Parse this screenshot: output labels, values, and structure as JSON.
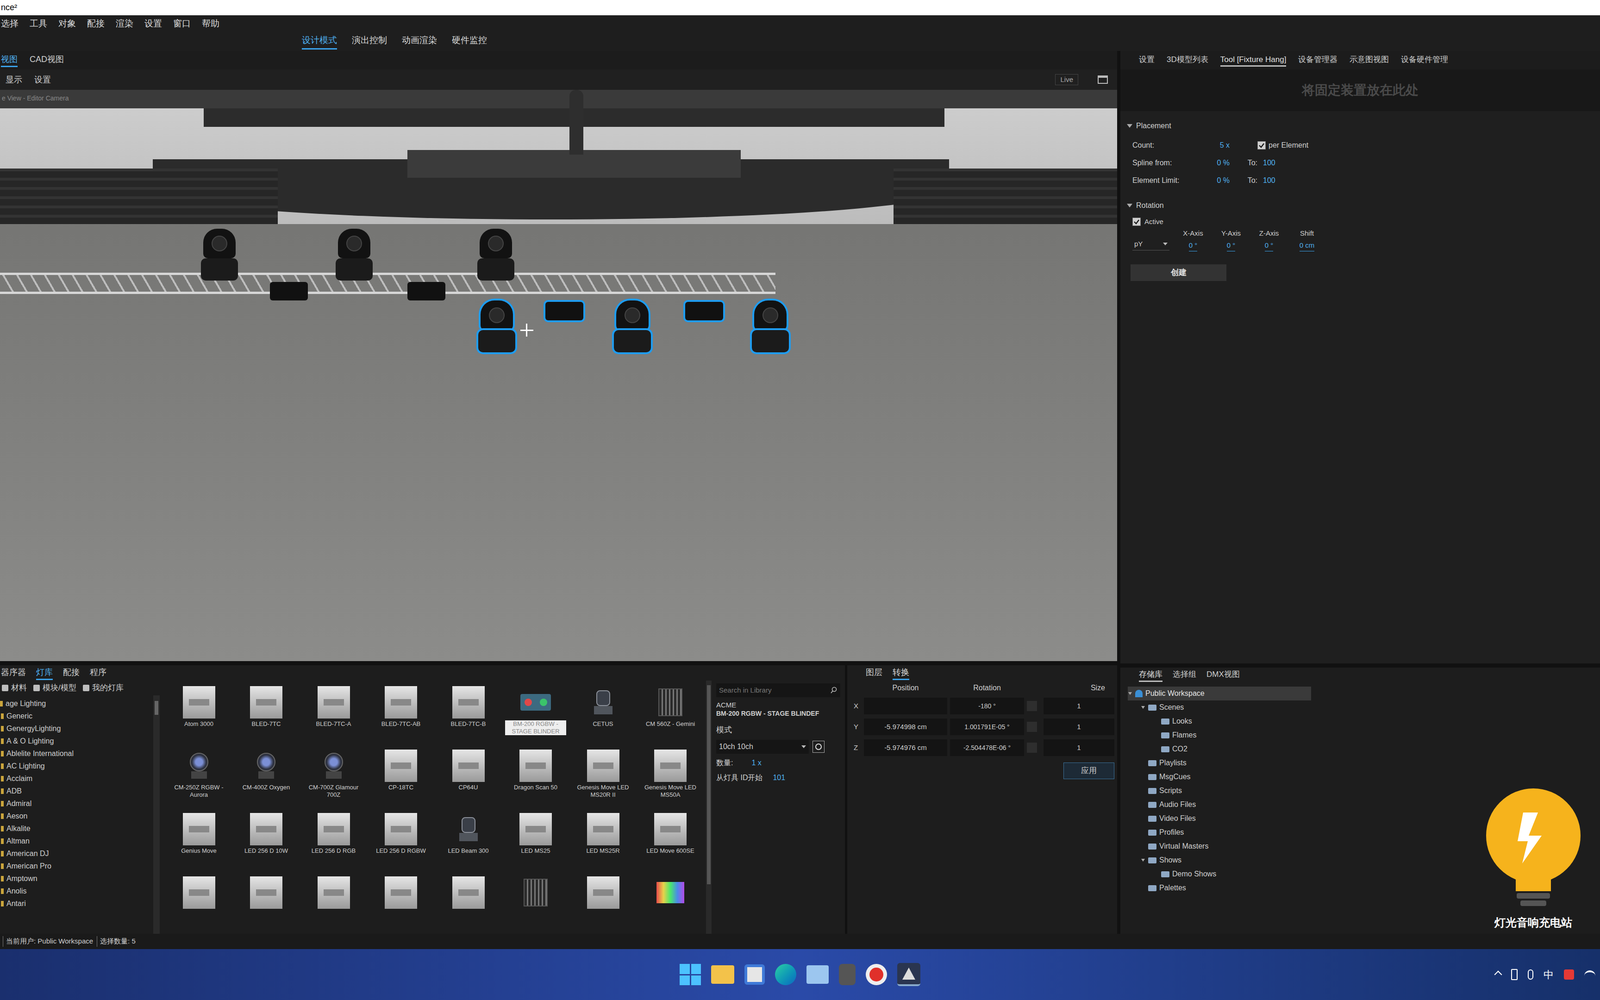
{
  "window": {
    "title": "nce²"
  },
  "menu": [
    "选择",
    "工具",
    "对象",
    "配接",
    "渲染",
    "设置",
    "窗口",
    "帮助"
  ],
  "modes": [
    {
      "label": "设计模式",
      "selected": true
    },
    {
      "label": "演出控制",
      "selected": false
    },
    {
      "label": "动画渲染",
      "selected": false
    },
    {
      "label": "硬件监控",
      "selected": false
    }
  ],
  "view_tabs": [
    {
      "label": "视图",
      "selected": true
    },
    {
      "label": "CAD视图",
      "selected": false
    }
  ],
  "view_toolbar": [
    "显示",
    "设置"
  ],
  "viewport": {
    "camera_label": "e View - Editor Camera",
    "live_button": "Live"
  },
  "library_tabs": [
    {
      "label": "器序器",
      "selected": false
    },
    {
      "label": "灯库",
      "selected": true
    },
    {
      "label": "配接",
      "selected": false
    },
    {
      "label": "程序",
      "selected": false
    }
  ],
  "library_toolbar": [
    "材料",
    "模块/模型",
    "我的灯库"
  ],
  "manufacturers": [
    "age Lighting",
    "Generic",
    "GenergyLighting",
    "A & O Lighting",
    "Ablelite International",
    "AC Lighting",
    "Acclaim",
    "ADB",
    "Admiral",
    "Aeson",
    "Alkalite",
    "Altman",
    "American DJ",
    "American Pro",
    "Amptown",
    "Anolis",
    "Antari"
  ],
  "fixtures": [
    {
      "label": "Atom 3000",
      "selected": false,
      "kind": "placeholder"
    },
    {
      "label": "BLED-7TC",
      "selected": false,
      "kind": "placeholder"
    },
    {
      "label": "BLED-7TC-A",
      "selected": false,
      "kind": "placeholder"
    },
    {
      "label": "BLED-7TC-AB",
      "selected": false,
      "kind": "placeholder"
    },
    {
      "label": "BLED-7TC-B",
      "selected": false,
      "kind": "placeholder"
    },
    {
      "label": "BM-200 RGBW - STAGE BLINDER",
      "selected": true,
      "kind": "blinder"
    },
    {
      "label": "CETUS",
      "selected": false,
      "kind": "head"
    },
    {
      "label": "CM 560Z - Gemini",
      "selected": false,
      "kind": "bar"
    },
    {
      "label": "CM-250Z RGBW - Aurora",
      "selected": false,
      "kind": "wash"
    },
    {
      "label": "CM-400Z Oxygen",
      "selected": false,
      "kind": "wash"
    },
    {
      "label": "CM-700Z Glamour 700Z",
      "selected": false,
      "kind": "wash"
    },
    {
      "label": "CP-18TC",
      "selected": false,
      "kind": "placeholder"
    },
    {
      "label": "CP64U",
      "selected": false,
      "kind": "placeholder"
    },
    {
      "label": "Dragon Scan 50",
      "selected": false,
      "kind": "placeholder"
    },
    {
      "label": "Genesis Move LED MS20R II",
      "selected": false,
      "kind": "placeholder"
    },
    {
      "label": "Genesis Move LED MS50A",
      "selected": false,
      "kind": "placeholder"
    },
    {
      "label": "Genius Move",
      "selected": false,
      "kind": "placeholder"
    },
    {
      "label": "LED 256 D 10W",
      "selected": false,
      "kind": "placeholder"
    },
    {
      "label": "LED 256 D RGB",
      "selected": false,
      "kind": "placeholder"
    },
    {
      "label": "LED 256 D RGBW",
      "selected": false,
      "kind": "placeholder"
    },
    {
      "label": "LED Beam 300",
      "selected": false,
      "kind": "head"
    },
    {
      "label": "LED MS25",
      "selected": false,
      "kind": "placeholder"
    },
    {
      "label": "LED MS25R",
      "selected": false,
      "kind": "placeholder"
    },
    {
      "label": "LED Move 600SE",
      "selected": false,
      "kind": "placeholder"
    }
  ],
  "fixtures_partial": [
    {
      "kind": "placeholder"
    },
    {
      "kind": "placeholder"
    },
    {
      "kind": "placeholder"
    },
    {
      "kind": "placeholder"
    },
    {
      "kind": "placeholder"
    },
    {
      "kind": "bar"
    },
    {
      "kind": "placeholder"
    },
    {
      "kind": "panel"
    }
  ],
  "library_search": {
    "placeholder": "Search in Library"
  },
  "fixture_info": {
    "manufacturer": "ACME",
    "name": "BM-200 RGBW - STAGE BLINDEF",
    "mode_label": "模式",
    "mode_value": "10ch 10ch",
    "count_label": "数量:",
    "count_value": "1 x",
    "start_id_label": "从灯具 ID开始",
    "start_id_value": "101"
  },
  "transform_tabs": [
    {
      "label": "图层",
      "selected": false
    },
    {
      "label": "转换",
      "selected": true
    }
  ],
  "transform": {
    "columns": [
      "Position",
      "Rotation",
      "Size"
    ],
    "rows": [
      {
        "axis": "X",
        "position": "",
        "rotation": "-180 °",
        "size": "1"
      },
      {
        "axis": "Y",
        "position": "-5.974998 cm",
        "rotation": "1.001791E-05 °",
        "size": "1"
      },
      {
        "axis": "Z",
        "position": "-5.974976 cm",
        "rotation": "-2.504478E-06 °",
        "size": "1"
      }
    ],
    "apply_button": "应用"
  },
  "right_tabs": [
    {
      "label": "设置",
      "selected": false
    },
    {
      "label": "3D模型列表",
      "selected": false
    },
    {
      "label": "Tool [Fixture Hang]",
      "selected": true
    },
    {
      "label": "设备管理器",
      "selected": false
    },
    {
      "label": "示意图视图",
      "selected": false
    },
    {
      "label": "设备硬件管理",
      "selected": false
    }
  ],
  "tool": {
    "drop_hint": "将固定装置放在此处",
    "placement": {
      "title": "Placement",
      "count_label": "Count:",
      "count_value": "5 x",
      "per_element": {
        "label": "per Element",
        "checked": true
      },
      "spline_label": "Spline from:",
      "spline_from": "0 %",
      "to_label": "To:",
      "spline_to": "100",
      "limit_label": "Element Limit:",
      "limit_from": "0 %",
      "limit_to": "100"
    },
    "rotation": {
      "title": "Rotation",
      "active": {
        "label": "Active",
        "checked": true
      },
      "axis_select": "pY",
      "columns": [
        {
          "label": "X-Axis",
          "value": "0 °"
        },
        {
          "label": "Y-Axis",
          "value": "0 °"
        },
        {
          "label": "Z-Axis",
          "value": "0 °"
        },
        {
          "label": "Shift",
          "value": "0 cm"
        }
      ]
    },
    "create_button": "创建"
  },
  "storage_tabs": [
    {
      "label": "存储库",
      "selected": true
    },
    {
      "label": "选择组",
      "selected": false
    },
    {
      "label": "DMX视图",
      "selected": false
    }
  ],
  "tree": [
    {
      "label": "Public Workspace",
      "depth": 0,
      "kind": "user",
      "expandable": true,
      "expanded": true,
      "selected": true
    },
    {
      "label": "Scenes",
      "depth": 1,
      "kind": "folder",
      "expandable": true,
      "expanded": true,
      "selected": false
    },
    {
      "label": "Looks",
      "depth": 2,
      "kind": "folder",
      "expandable": false,
      "expanded": false,
      "selected": false
    },
    {
      "label": "Flames",
      "depth": 2,
      "kind": "folder",
      "expandable": false,
      "expanded": false,
      "selected": false
    },
    {
      "label": "CO2",
      "depth": 2,
      "kind": "folder",
      "expandable": false,
      "expanded": false,
      "selected": false
    },
    {
      "label": "Playlists",
      "depth": 1,
      "kind": "folder",
      "expandable": false,
      "expanded": false,
      "selected": false
    },
    {
      "label": "MsgCues",
      "depth": 1,
      "kind": "folder",
      "expandable": false,
      "expanded": false,
      "selected": false
    },
    {
      "label": "Scripts",
      "depth": 1,
      "kind": "folder",
      "expandable": false,
      "expanded": false,
      "selected": false
    },
    {
      "label": "Audio Files",
      "depth": 1,
      "kind": "folder",
      "expandable": false,
      "expanded": false,
      "selected": false
    },
    {
      "label": "Video Files",
      "depth": 1,
      "kind": "folder",
      "expandable": false,
      "expanded": false,
      "selected": false
    },
    {
      "label": "Profiles",
      "depth": 1,
      "kind": "folder",
      "expandable": false,
      "expanded": false,
      "selected": false
    },
    {
      "label": "Virtual Masters",
      "depth": 1,
      "kind": "folder",
      "expandable": false,
      "expanded": false,
      "selected": false
    },
    {
      "label": "Shows",
      "depth": 1,
      "kind": "folder",
      "expandable": true,
      "expanded": true,
      "selected": false
    },
    {
      "label": "Demo Shows",
      "depth": 2,
      "kind": "folder",
      "expandable": false,
      "expanded": false,
      "selected": false
    },
    {
      "label": "Palettes",
      "depth": 1,
      "kind": "folder",
      "expandable": false,
      "expanded": false,
      "selected": false
    }
  ],
  "watermark": "灯光音响充电站",
  "status_bar": {
    "user": "当前用户: Public Workspace",
    "selection": "选择数量: 5"
  },
  "taskbar": {
    "ime": "中"
  }
}
